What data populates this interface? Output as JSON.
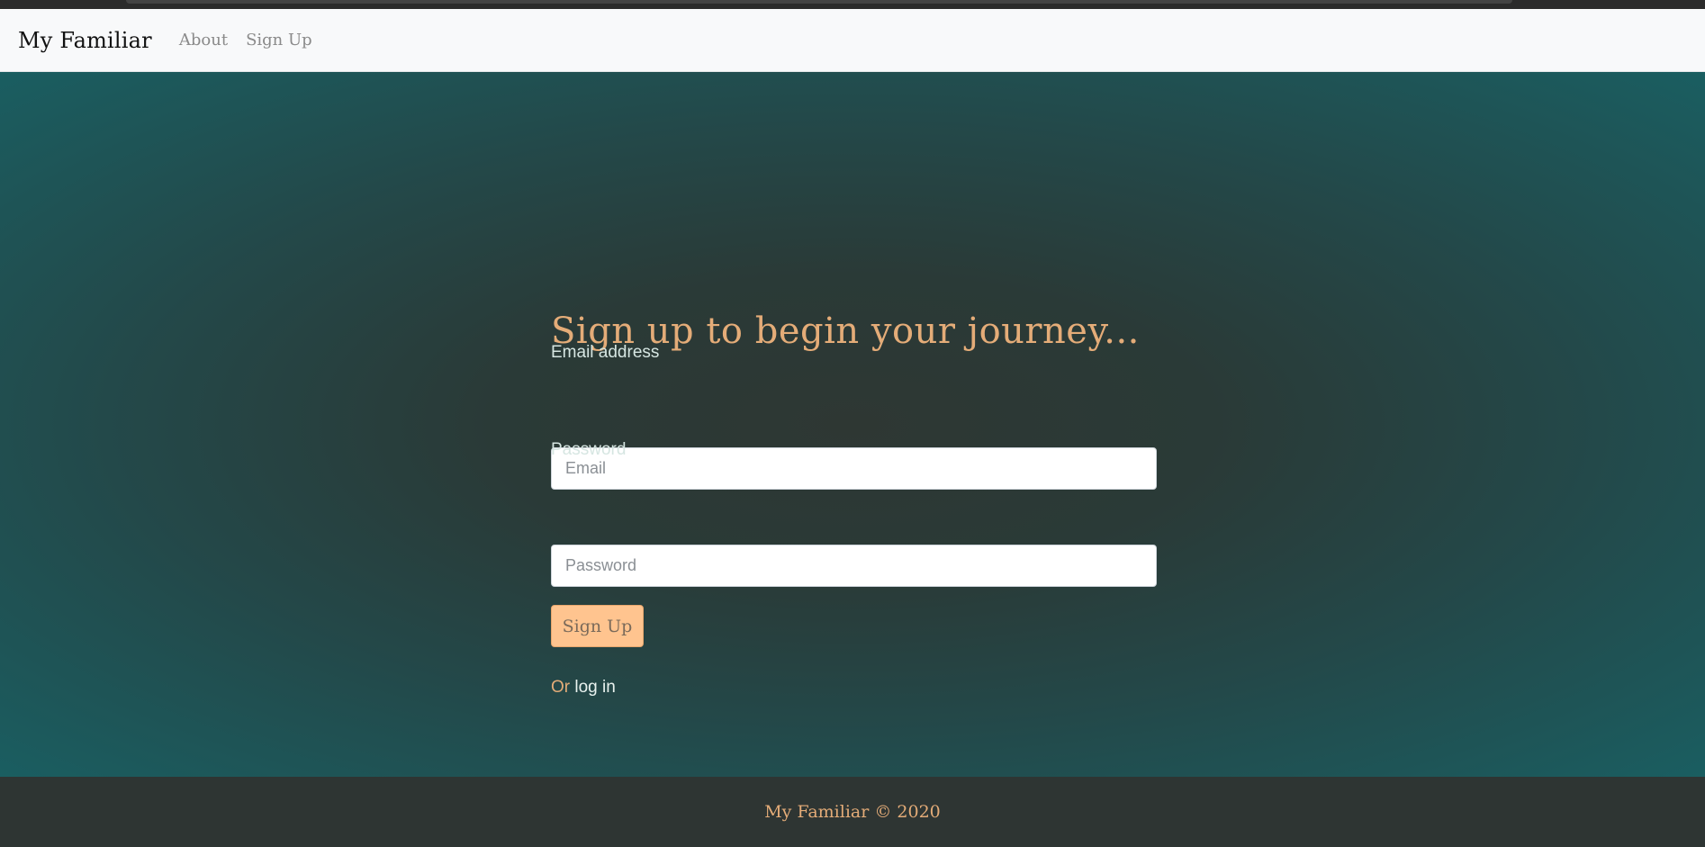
{
  "navbar": {
    "brand": "My Familiar",
    "links": [
      {
        "label": "About"
      },
      {
        "label": "Sign Up"
      }
    ]
  },
  "form": {
    "heading": "Sign up to begin your journey...",
    "email_label": "Email address",
    "email_placeholder": "Email",
    "email_value": "",
    "password_label": "Password",
    "password_placeholder": "Password",
    "password_value": "",
    "submit_label": "Sign Up",
    "alt_prefix": "Or",
    "alt_link": "log in"
  },
  "footer": {
    "text": "My Familiar © 2020"
  },
  "colors": {
    "accent": "#e4ac78",
    "button": "#ffc48f",
    "navbar_bg": "#f8f9fa",
    "footer_bg": "#2e3533",
    "hero_center": "#2e3733",
    "hero_edge": "#1a5e61"
  }
}
